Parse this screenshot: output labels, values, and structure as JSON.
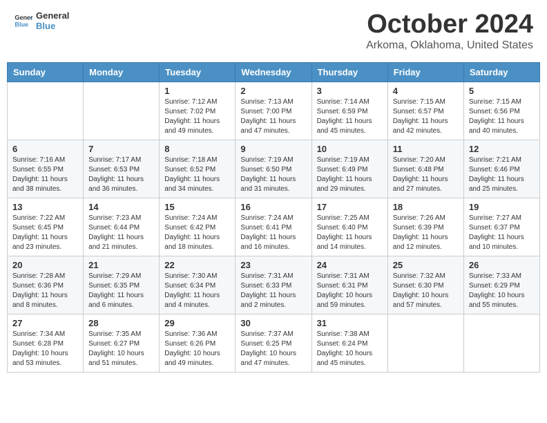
{
  "header": {
    "logo_text_general": "General",
    "logo_text_blue": "Blue",
    "month_title": "October 2024",
    "subtitle": "Arkoma, Oklahoma, United States"
  },
  "weekdays": [
    "Sunday",
    "Monday",
    "Tuesday",
    "Wednesday",
    "Thursday",
    "Friday",
    "Saturday"
  ],
  "weeks": [
    [
      {
        "day": "",
        "info": ""
      },
      {
        "day": "",
        "info": ""
      },
      {
        "day": "1",
        "info": "Sunrise: 7:12 AM\nSunset: 7:02 PM\nDaylight: 11 hours and 49 minutes."
      },
      {
        "day": "2",
        "info": "Sunrise: 7:13 AM\nSunset: 7:00 PM\nDaylight: 11 hours and 47 minutes."
      },
      {
        "day": "3",
        "info": "Sunrise: 7:14 AM\nSunset: 6:59 PM\nDaylight: 11 hours and 45 minutes."
      },
      {
        "day": "4",
        "info": "Sunrise: 7:15 AM\nSunset: 6:57 PM\nDaylight: 11 hours and 42 minutes."
      },
      {
        "day": "5",
        "info": "Sunrise: 7:15 AM\nSunset: 6:56 PM\nDaylight: 11 hours and 40 minutes."
      }
    ],
    [
      {
        "day": "6",
        "info": "Sunrise: 7:16 AM\nSunset: 6:55 PM\nDaylight: 11 hours and 38 minutes."
      },
      {
        "day": "7",
        "info": "Sunrise: 7:17 AM\nSunset: 6:53 PM\nDaylight: 11 hours and 36 minutes."
      },
      {
        "day": "8",
        "info": "Sunrise: 7:18 AM\nSunset: 6:52 PM\nDaylight: 11 hours and 34 minutes."
      },
      {
        "day": "9",
        "info": "Sunrise: 7:19 AM\nSunset: 6:50 PM\nDaylight: 11 hours and 31 minutes."
      },
      {
        "day": "10",
        "info": "Sunrise: 7:19 AM\nSunset: 6:49 PM\nDaylight: 11 hours and 29 minutes."
      },
      {
        "day": "11",
        "info": "Sunrise: 7:20 AM\nSunset: 6:48 PM\nDaylight: 11 hours and 27 minutes."
      },
      {
        "day": "12",
        "info": "Sunrise: 7:21 AM\nSunset: 6:46 PM\nDaylight: 11 hours and 25 minutes."
      }
    ],
    [
      {
        "day": "13",
        "info": "Sunrise: 7:22 AM\nSunset: 6:45 PM\nDaylight: 11 hours and 23 minutes."
      },
      {
        "day": "14",
        "info": "Sunrise: 7:23 AM\nSunset: 6:44 PM\nDaylight: 11 hours and 21 minutes."
      },
      {
        "day": "15",
        "info": "Sunrise: 7:24 AM\nSunset: 6:42 PM\nDaylight: 11 hours and 18 minutes."
      },
      {
        "day": "16",
        "info": "Sunrise: 7:24 AM\nSunset: 6:41 PM\nDaylight: 11 hours and 16 minutes."
      },
      {
        "day": "17",
        "info": "Sunrise: 7:25 AM\nSunset: 6:40 PM\nDaylight: 11 hours and 14 minutes."
      },
      {
        "day": "18",
        "info": "Sunrise: 7:26 AM\nSunset: 6:39 PM\nDaylight: 11 hours and 12 minutes."
      },
      {
        "day": "19",
        "info": "Sunrise: 7:27 AM\nSunset: 6:37 PM\nDaylight: 11 hours and 10 minutes."
      }
    ],
    [
      {
        "day": "20",
        "info": "Sunrise: 7:28 AM\nSunset: 6:36 PM\nDaylight: 11 hours and 8 minutes."
      },
      {
        "day": "21",
        "info": "Sunrise: 7:29 AM\nSunset: 6:35 PM\nDaylight: 11 hours and 6 minutes."
      },
      {
        "day": "22",
        "info": "Sunrise: 7:30 AM\nSunset: 6:34 PM\nDaylight: 11 hours and 4 minutes."
      },
      {
        "day": "23",
        "info": "Sunrise: 7:31 AM\nSunset: 6:33 PM\nDaylight: 11 hours and 2 minutes."
      },
      {
        "day": "24",
        "info": "Sunrise: 7:31 AM\nSunset: 6:31 PM\nDaylight: 10 hours and 59 minutes."
      },
      {
        "day": "25",
        "info": "Sunrise: 7:32 AM\nSunset: 6:30 PM\nDaylight: 10 hours and 57 minutes."
      },
      {
        "day": "26",
        "info": "Sunrise: 7:33 AM\nSunset: 6:29 PM\nDaylight: 10 hours and 55 minutes."
      }
    ],
    [
      {
        "day": "27",
        "info": "Sunrise: 7:34 AM\nSunset: 6:28 PM\nDaylight: 10 hours and 53 minutes."
      },
      {
        "day": "28",
        "info": "Sunrise: 7:35 AM\nSunset: 6:27 PM\nDaylight: 10 hours and 51 minutes."
      },
      {
        "day": "29",
        "info": "Sunrise: 7:36 AM\nSunset: 6:26 PM\nDaylight: 10 hours and 49 minutes."
      },
      {
        "day": "30",
        "info": "Sunrise: 7:37 AM\nSunset: 6:25 PM\nDaylight: 10 hours and 47 minutes."
      },
      {
        "day": "31",
        "info": "Sunrise: 7:38 AM\nSunset: 6:24 PM\nDaylight: 10 hours and 45 minutes."
      },
      {
        "day": "",
        "info": ""
      },
      {
        "day": "",
        "info": ""
      }
    ]
  ]
}
